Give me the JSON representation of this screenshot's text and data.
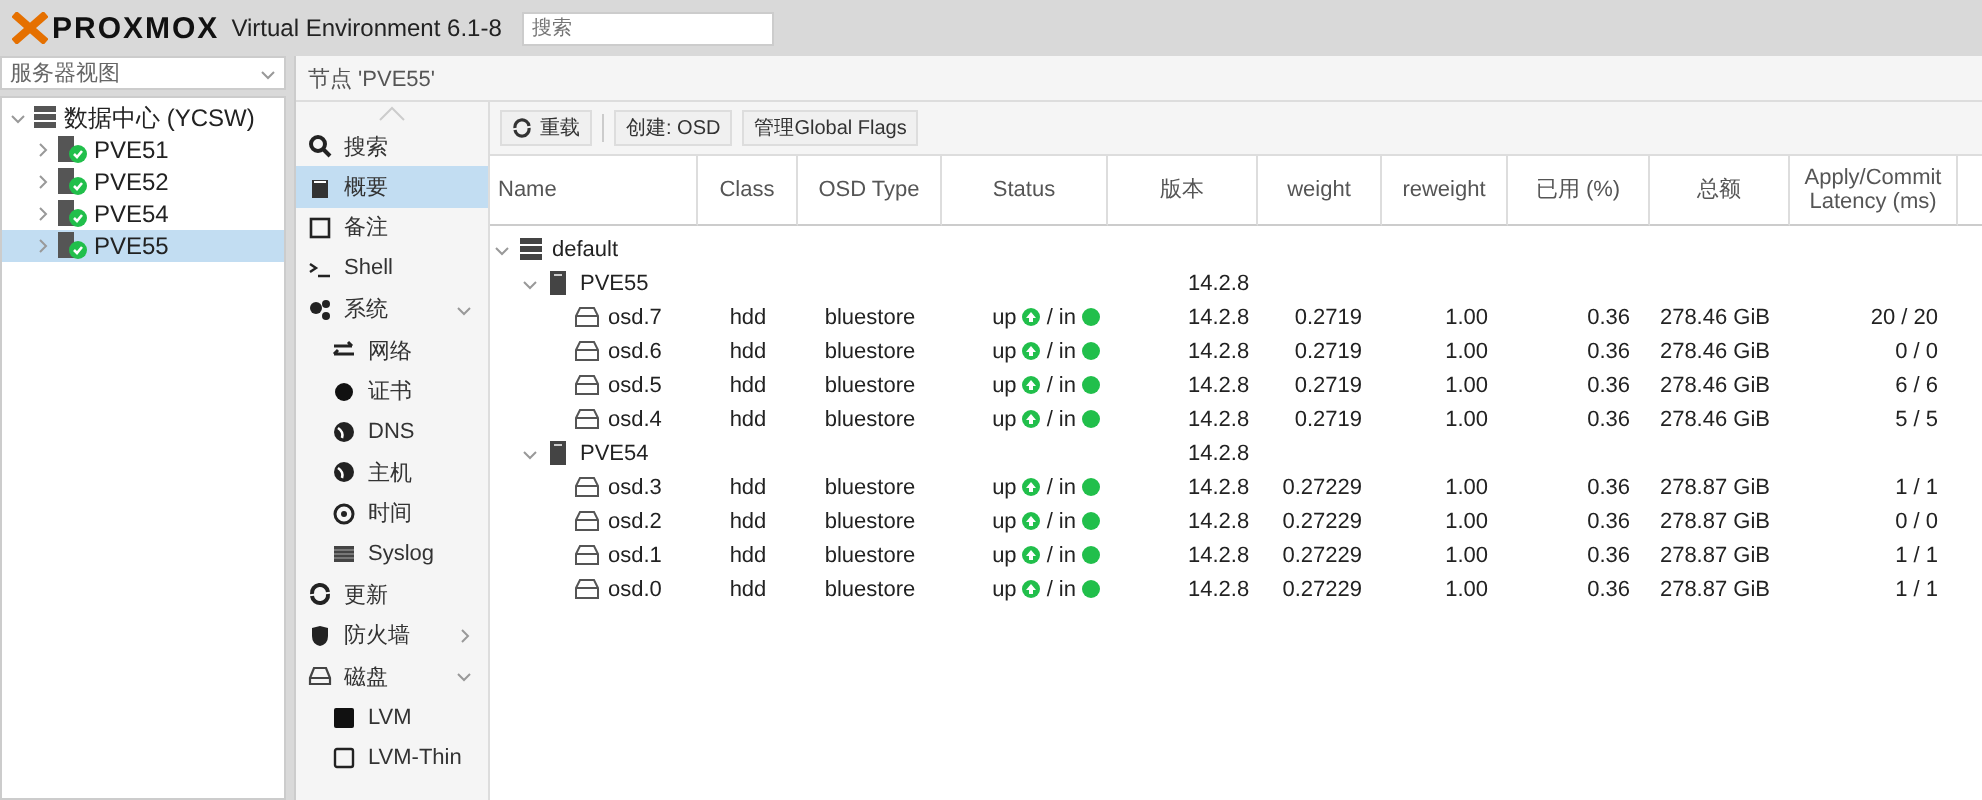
{
  "header": {
    "logo": "PROXMOX",
    "version": "Virtual Environment 6.1-8",
    "search": {
      "placeholder": "搜索"
    }
  },
  "resource_tree": {
    "view_selector": "服务器视图",
    "root": {
      "label": "数据中心 (YCSW)",
      "expanded": true,
      "children": [
        {
          "label": "PVE51",
          "selected": false
        },
        {
          "label": "PVE52",
          "selected": false
        },
        {
          "label": "PVE54",
          "selected": false
        },
        {
          "label": "PVE55",
          "selected": true
        }
      ]
    }
  },
  "breadcrumb": "节点 'PVE55'",
  "nav": [
    {
      "kind": "item",
      "label": "搜索",
      "selected": false
    },
    {
      "kind": "item",
      "label": "概要",
      "selected": true
    },
    {
      "kind": "item",
      "label": "备注",
      "selected": false
    },
    {
      "kind": "item",
      "label": "Shell",
      "selected": false
    },
    {
      "kind": "group",
      "label": "系统",
      "selected": false,
      "expanded": true
    },
    {
      "kind": "sub",
      "label": "网络",
      "selected": false
    },
    {
      "kind": "sub",
      "label": "证书",
      "selected": false
    },
    {
      "kind": "sub",
      "label": "DNS",
      "selected": false
    },
    {
      "kind": "sub",
      "label": "主机",
      "selected": false
    },
    {
      "kind": "sub",
      "label": "时间",
      "selected": false
    },
    {
      "kind": "sub",
      "label": "Syslog",
      "selected": false
    },
    {
      "kind": "item",
      "label": "更新",
      "selected": false
    },
    {
      "kind": "group",
      "label": "防火墙",
      "selected": false,
      "expanded": false
    },
    {
      "kind": "group",
      "label": "磁盘",
      "selected": false,
      "expanded": true
    },
    {
      "kind": "sub",
      "label": "LVM",
      "selected": false
    },
    {
      "kind": "sub",
      "label": "LVM-Thin",
      "selected": false
    }
  ],
  "toolbar": [
    {
      "kind": "reload",
      "label": "重载"
    },
    {
      "kind": "plain",
      "label": "创建: OSD"
    },
    {
      "kind": "plain",
      "label": "管理Global Flags"
    }
  ],
  "table": {
    "columns": [
      "Name",
      "Class",
      "OSD Type",
      "Status",
      "版本",
      "weight",
      "reweight",
      "已用 (%)",
      "总额",
      "Apply/Commit Latency (ms)"
    ],
    "rows": [
      {
        "kind": "root",
        "name": "default",
        "expanded": true,
        "children": [
          {
            "kind": "host",
            "name": "PVE55",
            "version": "14.2.8",
            "expanded": true,
            "children": [
              {
                "kind": "osd",
                "name": "osd.7",
                "class": "hdd",
                "osd_type": "bluestore",
                "status_up": "up",
                "status_in": "/ in",
                "version": "14.2.8",
                "weight": "0.2719",
                "reweight": "1.00",
                "used": "0.36",
                "total": "278.46 GiB",
                "latency": "20 / 20"
              },
              {
                "kind": "osd",
                "name": "osd.6",
                "class": "hdd",
                "osd_type": "bluestore",
                "status_up": "up",
                "status_in": "/ in",
                "version": "14.2.8",
                "weight": "0.2719",
                "reweight": "1.00",
                "used": "0.36",
                "total": "278.46 GiB",
                "latency": "0 / 0"
              },
              {
                "kind": "osd",
                "name": "osd.5",
                "class": "hdd",
                "osd_type": "bluestore",
                "status_up": "up",
                "status_in": "/ in",
                "version": "14.2.8",
                "weight": "0.2719",
                "reweight": "1.00",
                "used": "0.36",
                "total": "278.46 GiB",
                "latency": "6 / 6"
              },
              {
                "kind": "osd",
                "name": "osd.4",
                "class": "hdd",
                "osd_type": "bluestore",
                "status_up": "up",
                "status_in": "/ in",
                "version": "14.2.8",
                "weight": "0.2719",
                "reweight": "1.00",
                "used": "0.36",
                "total": "278.46 GiB",
                "latency": "5 / 5"
              }
            ]
          },
          {
            "kind": "host",
            "name": "PVE54",
            "version": "14.2.8",
            "expanded": true,
            "children": [
              {
                "kind": "osd",
                "name": "osd.3",
                "class": "hdd",
                "osd_type": "bluestore",
                "status_up": "up",
                "status_in": "/ in",
                "version": "14.2.8",
                "weight": "0.27229",
                "reweight": "1.00",
                "used": "0.36",
                "total": "278.87 GiB",
                "latency": "1 / 1"
              },
              {
                "kind": "osd",
                "name": "osd.2",
                "class": "hdd",
                "osd_type": "bluestore",
                "status_up": "up",
                "status_in": "/ in",
                "version": "14.2.8",
                "weight": "0.27229",
                "reweight": "1.00",
                "used": "0.36",
                "total": "278.87 GiB",
                "latency": "0 / 0"
              },
              {
                "kind": "osd",
                "name": "osd.1",
                "class": "hdd",
                "osd_type": "bluestore",
                "status_up": "up",
                "status_in": "/ in",
                "version": "14.2.8",
                "weight": "0.27229",
                "reweight": "1.00",
                "used": "0.36",
                "total": "278.87 GiB",
                "latency": "1 / 1"
              },
              {
                "kind": "osd",
                "name": "osd.0",
                "class": "hdd",
                "osd_type": "bluestore",
                "status_up": "up",
                "status_in": "/ in",
                "version": "14.2.8",
                "weight": "0.27229",
                "reweight": "1.00",
                "used": "0.36",
                "total": "278.87 GiB",
                "latency": "1 / 1"
              }
            ]
          }
        ]
      }
    ]
  }
}
